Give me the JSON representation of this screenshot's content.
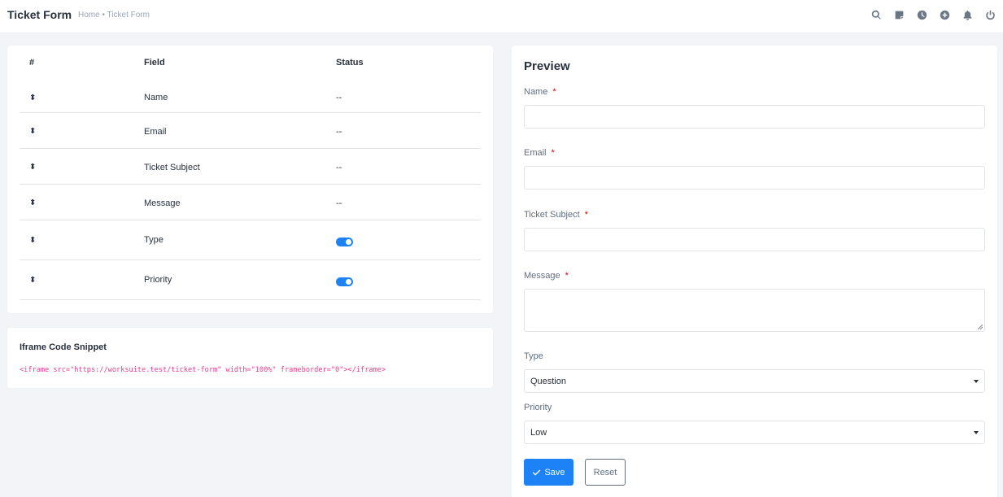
{
  "header": {
    "title": "Ticket Form",
    "breadcrumb": "Home • Ticket Form",
    "icons": [
      "search-icon",
      "sticky-note-icon",
      "clock-icon",
      "plus-circle-icon",
      "bell-icon",
      "power-icon"
    ]
  },
  "fields_table": {
    "columns": [
      "#",
      "Field",
      "Status"
    ],
    "rows": [
      {
        "drag": "⬍",
        "field": "Name",
        "status": "--"
      },
      {
        "drag": "⬍",
        "field": "Email",
        "status": "--"
      },
      {
        "drag": "⬍",
        "field": "Ticket Subject",
        "status": "--"
      },
      {
        "drag": "⬍",
        "field": "Message",
        "status": "--"
      },
      {
        "drag": "⬍",
        "field": "Type",
        "status": "toggle-on"
      },
      {
        "drag": "⬍",
        "field": "Priority",
        "status": "toggle-on"
      }
    ]
  },
  "iframe_snippet": {
    "title": "Iframe Code Snippet",
    "code": "<iframe src=\"https://worksuite.test/ticket-form\" width=\"100%\" frameborder=\"0\"></iframe>"
  },
  "preview": {
    "title": "Preview",
    "required_mark": "*",
    "name_label": "Name",
    "email_label": "Email",
    "subject_label": "Ticket Subject",
    "message_label": "Message",
    "type_label": "Type",
    "type_value": "Question",
    "priority_label": "Priority",
    "priority_value": "Low",
    "save_label": "Save",
    "reset_label": "Reset"
  },
  "colors": {
    "accent": "#1d82f5",
    "required": "#d30000",
    "code": "#e83e8c",
    "background": "#f2f4f7"
  }
}
